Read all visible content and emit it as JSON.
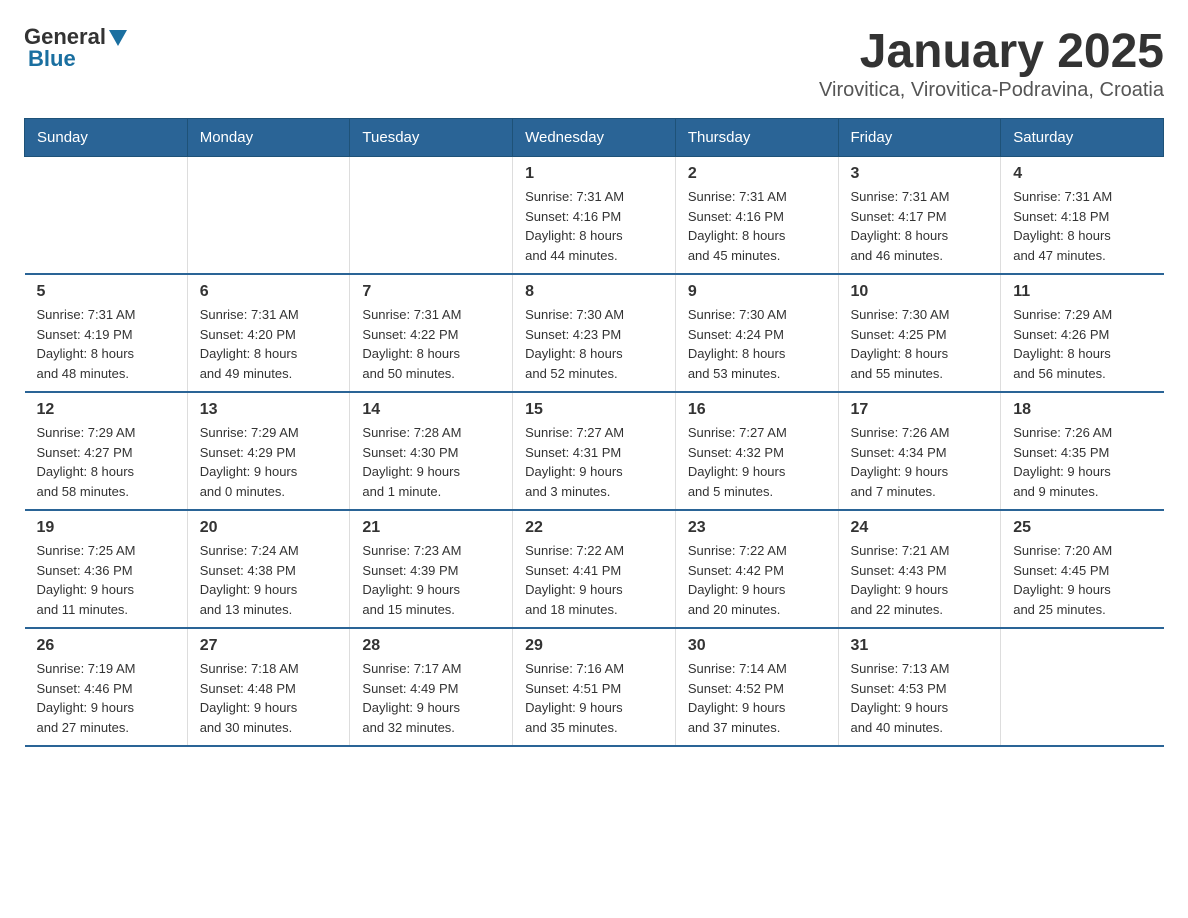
{
  "header": {
    "logo": {
      "text_general": "General",
      "text_blue": "Blue"
    },
    "title": "January 2025",
    "subtitle": "Virovitica, Virovitica-Podravina, Croatia"
  },
  "calendar": {
    "days_of_week": [
      "Sunday",
      "Monday",
      "Tuesday",
      "Wednesday",
      "Thursday",
      "Friday",
      "Saturday"
    ],
    "weeks": [
      [
        {
          "day": "",
          "info": ""
        },
        {
          "day": "",
          "info": ""
        },
        {
          "day": "",
          "info": ""
        },
        {
          "day": "1",
          "info": "Sunrise: 7:31 AM\nSunset: 4:16 PM\nDaylight: 8 hours\nand 44 minutes."
        },
        {
          "day": "2",
          "info": "Sunrise: 7:31 AM\nSunset: 4:16 PM\nDaylight: 8 hours\nand 45 minutes."
        },
        {
          "day": "3",
          "info": "Sunrise: 7:31 AM\nSunset: 4:17 PM\nDaylight: 8 hours\nand 46 minutes."
        },
        {
          "day": "4",
          "info": "Sunrise: 7:31 AM\nSunset: 4:18 PM\nDaylight: 8 hours\nand 47 minutes."
        }
      ],
      [
        {
          "day": "5",
          "info": "Sunrise: 7:31 AM\nSunset: 4:19 PM\nDaylight: 8 hours\nand 48 minutes."
        },
        {
          "day": "6",
          "info": "Sunrise: 7:31 AM\nSunset: 4:20 PM\nDaylight: 8 hours\nand 49 minutes."
        },
        {
          "day": "7",
          "info": "Sunrise: 7:31 AM\nSunset: 4:22 PM\nDaylight: 8 hours\nand 50 minutes."
        },
        {
          "day": "8",
          "info": "Sunrise: 7:30 AM\nSunset: 4:23 PM\nDaylight: 8 hours\nand 52 minutes."
        },
        {
          "day": "9",
          "info": "Sunrise: 7:30 AM\nSunset: 4:24 PM\nDaylight: 8 hours\nand 53 minutes."
        },
        {
          "day": "10",
          "info": "Sunrise: 7:30 AM\nSunset: 4:25 PM\nDaylight: 8 hours\nand 55 minutes."
        },
        {
          "day": "11",
          "info": "Sunrise: 7:29 AM\nSunset: 4:26 PM\nDaylight: 8 hours\nand 56 minutes."
        }
      ],
      [
        {
          "day": "12",
          "info": "Sunrise: 7:29 AM\nSunset: 4:27 PM\nDaylight: 8 hours\nand 58 minutes."
        },
        {
          "day": "13",
          "info": "Sunrise: 7:29 AM\nSunset: 4:29 PM\nDaylight: 9 hours\nand 0 minutes."
        },
        {
          "day": "14",
          "info": "Sunrise: 7:28 AM\nSunset: 4:30 PM\nDaylight: 9 hours\nand 1 minute."
        },
        {
          "day": "15",
          "info": "Sunrise: 7:27 AM\nSunset: 4:31 PM\nDaylight: 9 hours\nand 3 minutes."
        },
        {
          "day": "16",
          "info": "Sunrise: 7:27 AM\nSunset: 4:32 PM\nDaylight: 9 hours\nand 5 minutes."
        },
        {
          "day": "17",
          "info": "Sunrise: 7:26 AM\nSunset: 4:34 PM\nDaylight: 9 hours\nand 7 minutes."
        },
        {
          "day": "18",
          "info": "Sunrise: 7:26 AM\nSunset: 4:35 PM\nDaylight: 9 hours\nand 9 minutes."
        }
      ],
      [
        {
          "day": "19",
          "info": "Sunrise: 7:25 AM\nSunset: 4:36 PM\nDaylight: 9 hours\nand 11 minutes."
        },
        {
          "day": "20",
          "info": "Sunrise: 7:24 AM\nSunset: 4:38 PM\nDaylight: 9 hours\nand 13 minutes."
        },
        {
          "day": "21",
          "info": "Sunrise: 7:23 AM\nSunset: 4:39 PM\nDaylight: 9 hours\nand 15 minutes."
        },
        {
          "day": "22",
          "info": "Sunrise: 7:22 AM\nSunset: 4:41 PM\nDaylight: 9 hours\nand 18 minutes."
        },
        {
          "day": "23",
          "info": "Sunrise: 7:22 AM\nSunset: 4:42 PM\nDaylight: 9 hours\nand 20 minutes."
        },
        {
          "day": "24",
          "info": "Sunrise: 7:21 AM\nSunset: 4:43 PM\nDaylight: 9 hours\nand 22 minutes."
        },
        {
          "day": "25",
          "info": "Sunrise: 7:20 AM\nSunset: 4:45 PM\nDaylight: 9 hours\nand 25 minutes."
        }
      ],
      [
        {
          "day": "26",
          "info": "Sunrise: 7:19 AM\nSunset: 4:46 PM\nDaylight: 9 hours\nand 27 minutes."
        },
        {
          "day": "27",
          "info": "Sunrise: 7:18 AM\nSunset: 4:48 PM\nDaylight: 9 hours\nand 30 minutes."
        },
        {
          "day": "28",
          "info": "Sunrise: 7:17 AM\nSunset: 4:49 PM\nDaylight: 9 hours\nand 32 minutes."
        },
        {
          "day": "29",
          "info": "Sunrise: 7:16 AM\nSunset: 4:51 PM\nDaylight: 9 hours\nand 35 minutes."
        },
        {
          "day": "30",
          "info": "Sunrise: 7:14 AM\nSunset: 4:52 PM\nDaylight: 9 hours\nand 37 minutes."
        },
        {
          "day": "31",
          "info": "Sunrise: 7:13 AM\nSunset: 4:53 PM\nDaylight: 9 hours\nand 40 minutes."
        },
        {
          "day": "",
          "info": ""
        }
      ]
    ]
  }
}
